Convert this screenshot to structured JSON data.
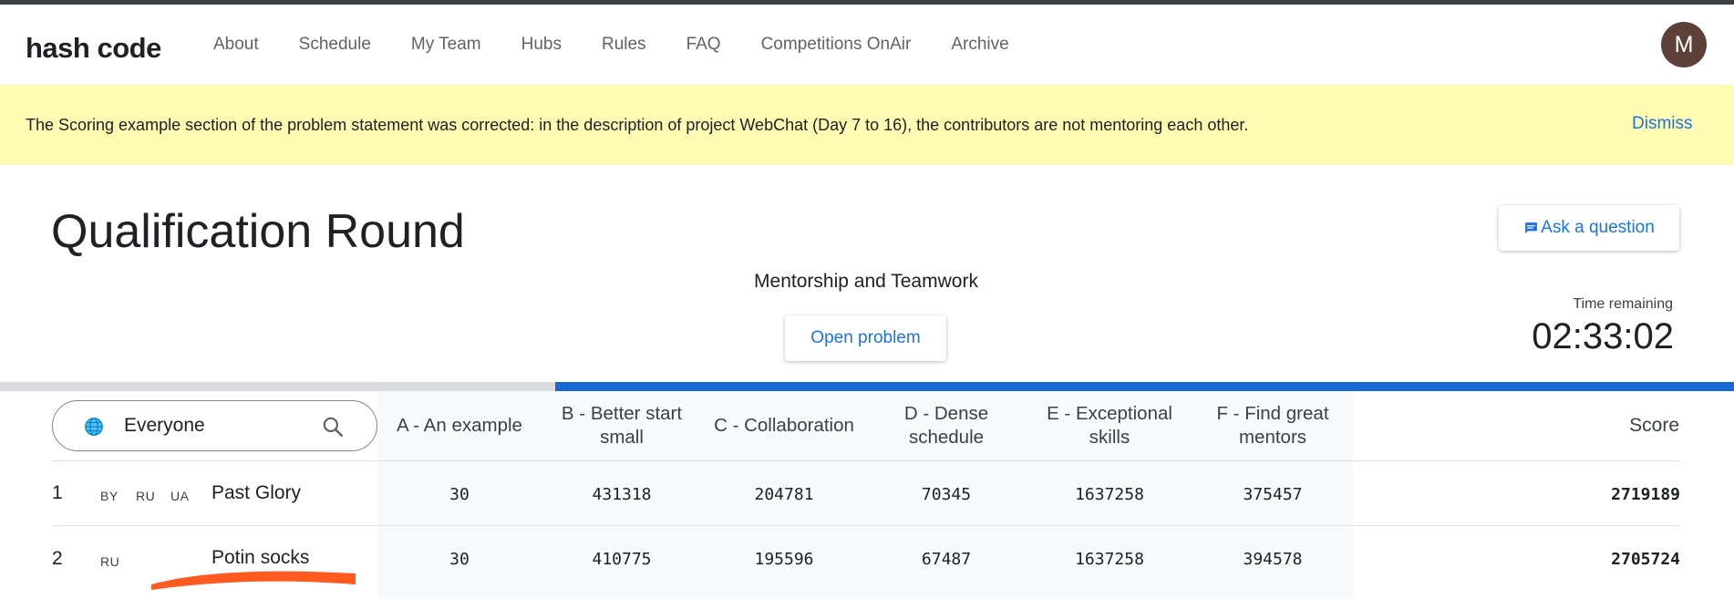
{
  "header": {
    "logo": "hash code",
    "nav": [
      "About",
      "Schedule",
      "My Team",
      "Hubs",
      "Rules",
      "FAQ",
      "Competitions OnAir",
      "Archive"
    ],
    "avatar_initial": "M"
  },
  "banner": {
    "text": "The Scoring example section of the problem statement was corrected: in the description of project WebChat (Day 7 to 16), the contributors are not mentoring each other.",
    "dismiss_label": "Dismiss"
  },
  "round": {
    "title": "Qualification Round",
    "ask_label": "Ask a question",
    "problem_name": "Mentorship and Teamwork",
    "open_label": "Open problem",
    "time_label": "Time remaining",
    "time_value": "02:33:02",
    "progress_fraction": 0.68
  },
  "leaderboard": {
    "filter_value": "Everyone",
    "columns": [
      "A - An example",
      "B - Better start small",
      "C - Collaboration",
      "D - Dense schedule",
      "E - Exceptional skills",
      "F - Find great mentors"
    ],
    "score_label": "Score",
    "rows": [
      {
        "rank": "1",
        "countries": [
          "BY",
          "RU",
          "UA"
        ],
        "team": "Past Glory",
        "scores": [
          "30",
          "431318",
          "204781",
          "70345",
          "1637258",
          "375457"
        ],
        "total": "2719189"
      },
      {
        "rank": "2",
        "countries": [
          "RU"
        ],
        "team": "Potin socks",
        "scores": [
          "30",
          "410775",
          "195596",
          "67487",
          "1637258",
          "394578"
        ],
        "total": "2705724"
      }
    ]
  },
  "colors": {
    "accent": "#1a73e8",
    "progress": "#1967d2",
    "banner_bg": "#fefcb3",
    "avatar_bg": "#5d4037",
    "scribble": "#ff5a1f"
  },
  "icons": {
    "ask": "chat-bubble-icon",
    "filter": "globe-icon",
    "search": "search-icon"
  }
}
